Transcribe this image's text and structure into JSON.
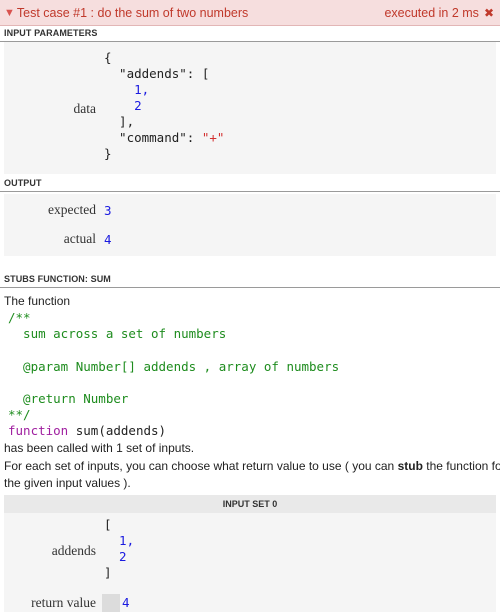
{
  "header": {
    "title": "Test case #1 : do the sum of two numbers",
    "status": "executed in 2 ms"
  },
  "sections": {
    "input_parameters": "INPUT PARAMETERS",
    "output": "OUTPUT",
    "stubs": "STUBS FUNCTION: SUM"
  },
  "input": {
    "label": "data",
    "lines": [
      "{",
      "  \"addends\": [",
      "    1,",
      "    2",
      "  ],",
      "  \"command\": \"+\"",
      "}"
    ]
  },
  "output": {
    "expected_label": "expected",
    "expected_value": "3",
    "actual_label": "actual",
    "actual_value": "4"
  },
  "stub": {
    "intro": "The function",
    "doc_open": "/**",
    "doc_desc": "  sum across a set of numbers",
    "doc_param": "  @param Number[] addends , array of numbers",
    "doc_return": "  @return Number",
    "doc_close": "**/",
    "sig_keyword": "function",
    "sig_rest": " sum(addends)",
    "called": "has been called with 1 set of inputs.",
    "explain_1": "For each set of inputs, you can choose what return value to use ( you can ",
    "explain_stub": "stub",
    "explain_2": " the function for",
    "explain_3": "the given input values )."
  },
  "input_set": {
    "title": "INPUT SET 0",
    "addends_label": "addends",
    "addends_lines": [
      "[",
      "  1,",
      "  2",
      "]"
    ],
    "return_label": "return value",
    "return_value": "4"
  }
}
